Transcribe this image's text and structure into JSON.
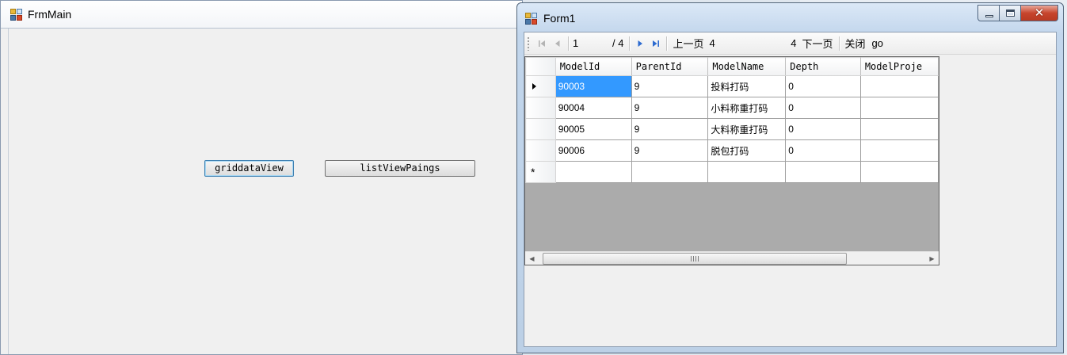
{
  "frm_main": {
    "title": "FrmMain",
    "buttons": {
      "grid": "griddataView",
      "list": "listViewPaings"
    }
  },
  "form1": {
    "title": "Form1",
    "caption": {
      "close_glyph": "✕"
    },
    "navigator": {
      "position": "1",
      "count": "/ 4",
      "prev_page": "上一页",
      "page_input": "4",
      "page_input_2": "4",
      "next_page": "下一页",
      "close": "关闭",
      "go": "go"
    },
    "grid": {
      "columns": [
        "ModelId",
        "ParentId",
        "ModelName",
        "Depth",
        "ModelProje"
      ],
      "rows": [
        [
          "90003",
          "9",
          "投料打码",
          "0",
          ""
        ],
        [
          "90004",
          "9",
          "小料称重打码",
          "0",
          ""
        ],
        [
          "90005",
          "9",
          "大料称重打码",
          "0",
          ""
        ],
        [
          "90006",
          "9",
          "脱包打码",
          "0",
          ""
        ]
      ],
      "new_row_marker": "*",
      "scroll_grip": "III"
    }
  },
  "icons": {
    "first": "first-record-icon",
    "prev": "previous-record-icon",
    "next": "next-record-icon",
    "last": "last-record-icon"
  },
  "colors": {
    "selection": "#3399ff",
    "close_button": "#c7452d",
    "grid_background": "#ababab"
  }
}
